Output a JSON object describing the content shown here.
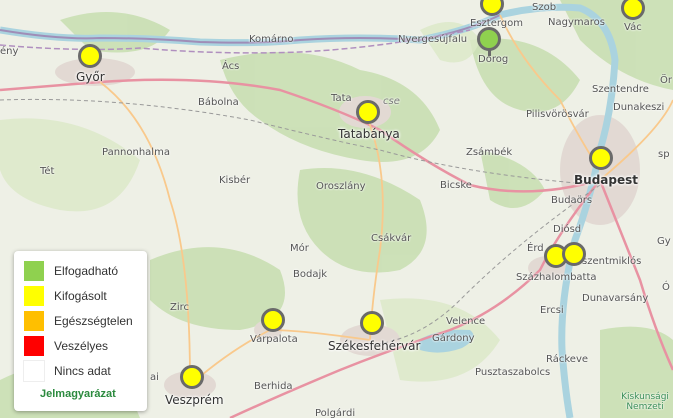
{
  "legend": {
    "items": [
      {
        "label": "Elfogadható",
        "color": "#8fd14f"
      },
      {
        "label": "Kifogásolt",
        "color": "#ffff00"
      },
      {
        "label": "Egészségtelen",
        "color": "#ffbf00"
      },
      {
        "label": "Veszélyes",
        "color": "#ff0000"
      },
      {
        "label": "Nincs adat",
        "color": "#ffffff"
      }
    ],
    "title": "Jelmagyarázat"
  },
  "places": {
    "gyor": "Győr",
    "tatabanya": "Tatabánya",
    "budapest": "Budapest",
    "szekesfehervar": "Székesfehérvár",
    "veszprem": "Veszprém",
    "varpalota": "Várpalota",
    "szazhalombatta": "Százhalombatta",
    "dorog": "Dorog",
    "esztergom": "Esztergom",
    "vac": "Vác",
    "komarno": "Komárno",
    "acs": "Ács",
    "nyergesujfalu": "Nyergesújfalu",
    "szob": "Szob",
    "nagymaros": "Nagymaros",
    "babolna": "Bábolna",
    "tata": "Tata",
    "pannonhalma": "Pannonhalma",
    "tet": "Tét",
    "kisber": "Kisbér",
    "oroszlany": "Oroszlány",
    "bicske": "Bicske",
    "zsambek": "Zsámbék",
    "pilisvorosvar": "Pilisvörösvár",
    "szentendre": "Szentendre",
    "dunakeszi": "Dunakeszi",
    "budaors": "Budaörs",
    "diosd": "Diósd",
    "szentmiklos": "szentmiklós",
    "dunavarsany": "Dunavarsány",
    "erd": "Érd",
    "ercsi": "Ercsi",
    "csakvar": "Csákvár",
    "mor": "Mór",
    "bodajk": "Bodajk",
    "zirc": "Zirc",
    "velence": "Velence",
    "gardony": "Gárdony",
    "berhida": "Berhida",
    "pusztaszabolcs": "Pusztaszabolcs",
    "rackeve": "Ráckeve",
    "polgardi": "Polgárdi",
    "kiskunsagi": "Kiskunsági Nemzeti",
    "eny": "ény",
    "or": "Ör",
    "gy": "Gy",
    "o": "Ó",
    "ssp": "sp",
    "cse": "cse",
    "ajka": "ai"
  },
  "stations": [
    {
      "name": "Győr",
      "status": "Kifogásolt",
      "color": "#ffff00"
    },
    {
      "name": "Tatabánya",
      "status": "Kifogásolt",
      "color": "#ffff00"
    },
    {
      "name": "Esztergom",
      "status": "Kifogásolt",
      "color": "#ffff00"
    },
    {
      "name": "Dorog",
      "status": "Elfogadható",
      "color": "#8fd14f"
    },
    {
      "name": "Vác",
      "status": "Kifogásolt",
      "color": "#ffff00"
    },
    {
      "name": "Budapest",
      "status": "Kifogásolt",
      "color": "#ffff00"
    },
    {
      "name": "Százhalombatta 1",
      "status": "Kifogásolt",
      "color": "#ffff00"
    },
    {
      "name": "Százhalombatta 2",
      "status": "Kifogásolt",
      "color": "#ffff00"
    },
    {
      "name": "Várpalota",
      "status": "Kifogásolt",
      "color": "#ffff00"
    },
    {
      "name": "Székesfehérvár",
      "status": "Kifogásolt",
      "color": "#ffff00"
    },
    {
      "name": "Veszprém",
      "status": "Kifogásolt",
      "color": "#ffff00"
    }
  ]
}
